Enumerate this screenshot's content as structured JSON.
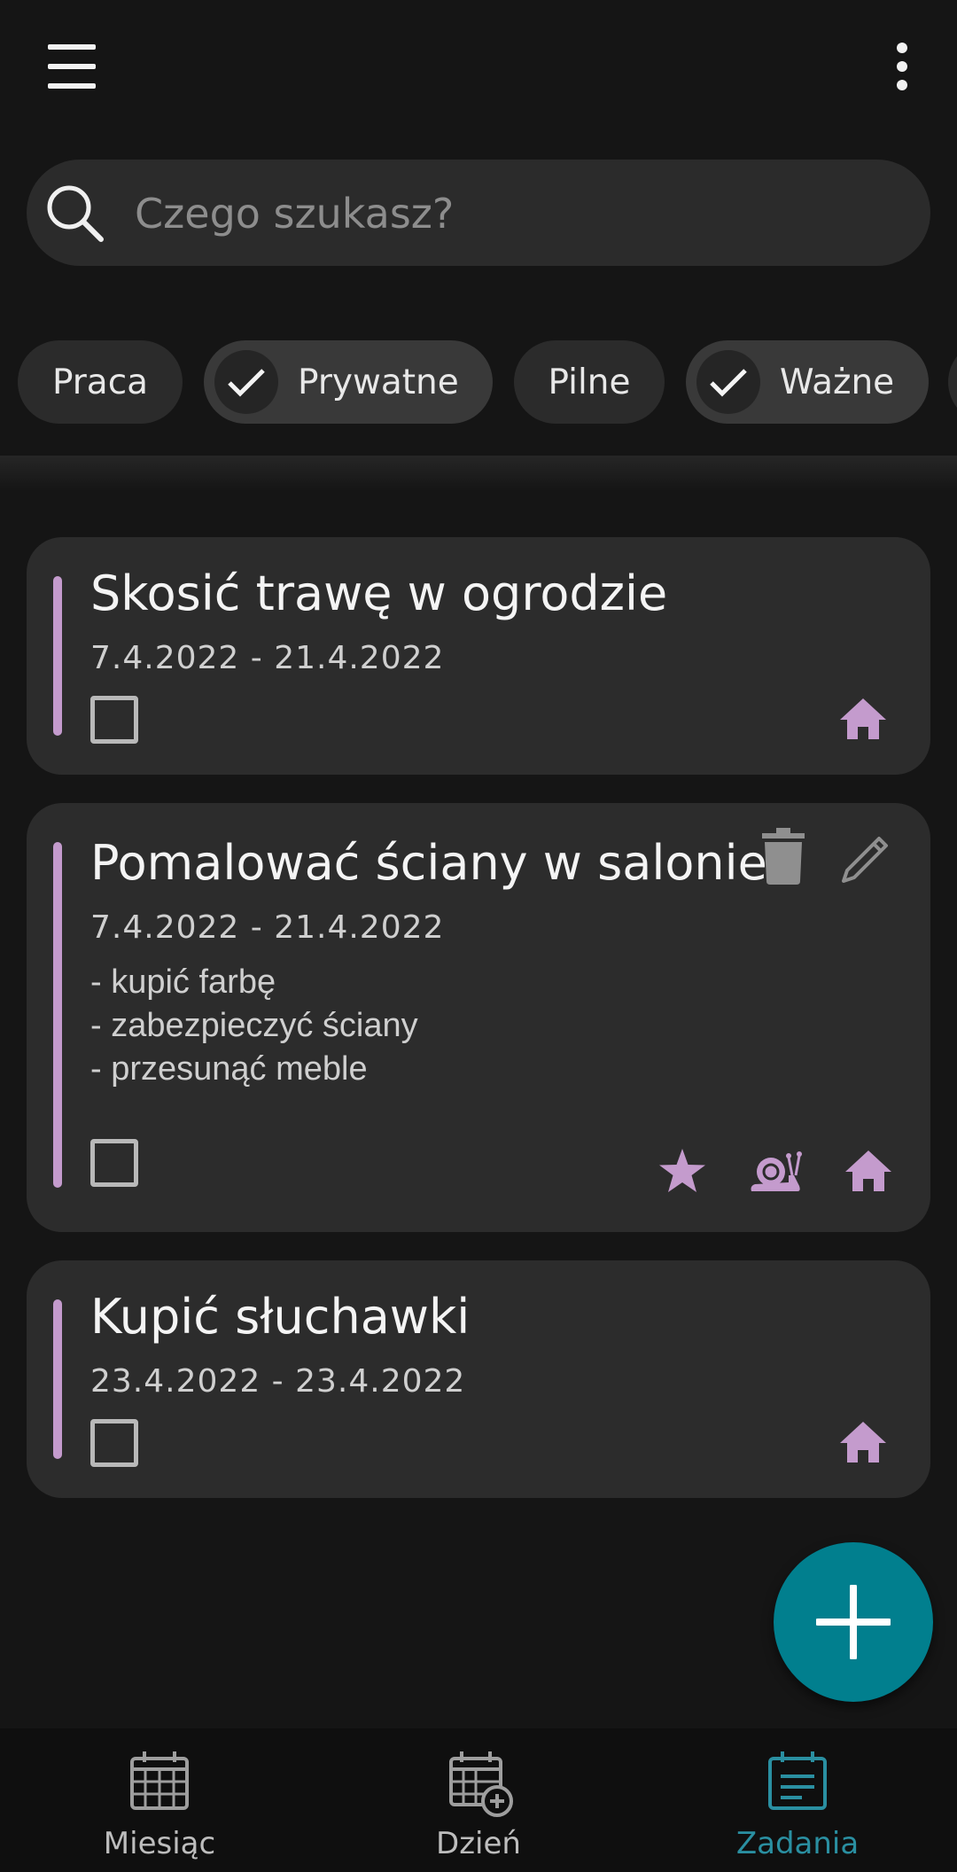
{
  "topbar": {
    "menu_icon": "menu-icon",
    "more_icon": "more-vert-icon"
  },
  "search": {
    "placeholder": "Czego szukasz?",
    "value": ""
  },
  "filters": [
    {
      "label": "Praca",
      "selected": false
    },
    {
      "label": "Prywatne",
      "selected": true
    },
    {
      "label": "Pilne",
      "selected": false
    },
    {
      "label": "Ważne",
      "selected": true
    }
  ],
  "tasks": [
    {
      "title": "Skosić trawę w ogrodzie",
      "dates": "7.4.2022 - 21.4.2022",
      "done": false,
      "tags": [
        "home-icon"
      ]
    },
    {
      "title": "Pomalować ściany w salonie",
      "dates": "7.4.2022 - 21.4.2022",
      "notes": [
        "- kupić farbę",
        "- zabezpieczyć ściany",
        "- przesunąć meble"
      ],
      "done": false,
      "actions": [
        "delete-icon",
        "edit-icon"
      ],
      "tags": [
        "star-icon",
        "snail-icon",
        "home-icon"
      ]
    },
    {
      "title": "Kupić słuchawki",
      "dates": "23.4.2022 - 23.4.2022",
      "done": false,
      "tags": [
        "home-icon"
      ]
    }
  ],
  "fab": {
    "icon": "add-icon"
  },
  "bottom_nav": [
    {
      "label": "Miesiąc",
      "icon": "calendar-month-icon",
      "active": false
    },
    {
      "label": "Dzień",
      "icon": "calendar-day-icon",
      "active": false
    },
    {
      "label": "Zadania",
      "icon": "tasks-icon",
      "active": true
    }
  ],
  "colors": {
    "accent": "#c49bcd",
    "primary": "#017f8e",
    "active_nav": "#2a8fa1",
    "background": "#151515",
    "card": "#2c2c2c"
  }
}
